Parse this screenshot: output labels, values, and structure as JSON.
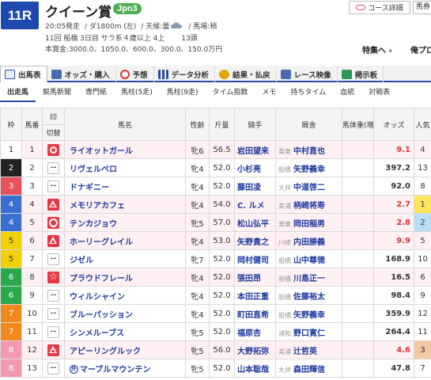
{
  "race": {
    "number": "11R",
    "name": "クイーン賞",
    "grade": "Jpn3",
    "time": "20:05発走",
    "distance": "/ ダ1800m (左)",
    "weather_label": "/ 天候:曇",
    "track": "/ 馬場:稍",
    "line2": "11回 船橋 3日目 サラ系４歳以上 4上",
    "line2_count": "13頭",
    "line3": "本賞金:3000.0、1050.0、600.0、300.0、150.0万円"
  },
  "header": {
    "course_button": "コース詳細",
    "side_button": "馬券",
    "special_link": "特集へ ›",
    "other_link": "俺プロ"
  },
  "tabs": [
    {
      "label": "出馬表",
      "icon": "document-icon"
    },
    {
      "label": "オッズ・購入",
      "icon": "odds-icon"
    },
    {
      "label": "予想",
      "icon": "target-icon"
    },
    {
      "label": "データ分析",
      "icon": "bar-chart-icon"
    },
    {
      "label": "結果・払戻",
      "icon": "coin-icon"
    },
    {
      "label": "レース映像",
      "icon": "video-icon"
    },
    {
      "label": "掲示板",
      "icon": "board-icon"
    }
  ],
  "subtabs": [
    "出走馬",
    "競馬新聞",
    "専門紙",
    "馬柱(5走)",
    "馬柱(9走)",
    "タイム指数",
    "メモ",
    "持ちタイム",
    "血統",
    "対戦表"
  ],
  "table": {
    "headers": {
      "waku": "枠",
      "umaban": "馬番",
      "mark_top": "印",
      "mark_bottom": "切替",
      "horse": "馬名",
      "sexage": "性齢",
      "kinryo": "斤量",
      "jockey": "騎手",
      "kyusha": "厩舎",
      "bw": "馬体重(増減)",
      "odds": "オッズ",
      "pop": "人気"
    },
    "rows": [
      {
        "waku": "1",
        "umaban": "1",
        "mark": "honmei",
        "name": "ライオットガール",
        "sexage": "牝6",
        "kinryo": "56.5",
        "jockey": "岩田望来",
        "area": "栗東",
        "trainer": "中村直也",
        "odds": "9.1",
        "pop": "4"
      },
      {
        "waku": "2",
        "umaban": "2",
        "mark": "none",
        "name": "リヴェルベロ",
        "sexage": "牝4",
        "kinryo": "52.0",
        "jockey": "小杉亮",
        "area": "船橋",
        "trainer": "矢野義幸",
        "odds": "397.2",
        "pop": "13"
      },
      {
        "waku": "3",
        "umaban": "3",
        "mark": "none",
        "name": "ドナギニー",
        "sexage": "牝4",
        "kinryo": "52.0",
        "jockey": "藤田凌",
        "area": "大井",
        "trainer": "中道啓二",
        "odds": "92.0",
        "pop": "8"
      },
      {
        "waku": "4",
        "umaban": "4",
        "mark": "tri",
        "name": "メモリアカフェ",
        "sexage": "牝4",
        "kinryo": "54.0",
        "jockey": "C. ルメ",
        "area": "美浦",
        "trainer": "柄崎将寿",
        "odds": "2.7",
        "pop": "1"
      },
      {
        "waku": "4",
        "umaban": "5",
        "mark": "circ",
        "name": "テンカジョウ",
        "sexage": "牝5",
        "kinryo": "57.0",
        "jockey": "松山弘平",
        "area": "栗東",
        "trainer": "岡田稲男",
        "odds": "2.8",
        "pop": "2"
      },
      {
        "waku": "5",
        "umaban": "6",
        "mark": "tri",
        "name": "ホーリーグレイル",
        "sexage": "牝4",
        "kinryo": "53.0",
        "jockey": "矢野貴之",
        "area": "川崎",
        "trainer": "内田勝義",
        "odds": "9.9",
        "pop": "5"
      },
      {
        "waku": "5",
        "umaban": "7",
        "mark": "none",
        "name": "ジゼル",
        "sexage": "牝7",
        "kinryo": "52.0",
        "jockey": "岡村健司",
        "area": "船橋",
        "trainer": "山中尊徳",
        "odds": "168.9",
        "pop": "10"
      },
      {
        "waku": "6",
        "umaban": "8",
        "mark": "star",
        "name": "プラウドフレール",
        "sexage": "牝4",
        "kinryo": "52.0",
        "jockey": "張田昂",
        "area": "船橋",
        "trainer": "川島正一",
        "odds": "16.5",
        "pop": "6"
      },
      {
        "waku": "6",
        "umaban": "9",
        "mark": "none",
        "name": "ウィルシャイン",
        "sexage": "牝4",
        "kinryo": "52.0",
        "jockey": "本田正重",
        "area": "船橋",
        "trainer": "佐藤裕太",
        "odds": "98.4",
        "pop": "9"
      },
      {
        "waku": "7",
        "umaban": "10",
        "mark": "none",
        "name": "ブルーパッション",
        "sexage": "牝4",
        "kinryo": "52.0",
        "jockey": "町田直希",
        "area": "船橋",
        "trainer": "矢野義幸",
        "odds": "359.9",
        "pop": "12"
      },
      {
        "waku": "7",
        "umaban": "11",
        "mark": "none",
        "name": "シンメルーブス",
        "sexage": "牝5",
        "kinryo": "52.0",
        "jockey": "福原杏",
        "area": "浦和",
        "trainer": "野口寛仁",
        "odds": "264.4",
        "pop": "11"
      },
      {
        "waku": "8",
        "umaban": "12",
        "mark": "tri",
        "name": "アピーリングルック",
        "sexage": "牝5",
        "kinryo": "56.0",
        "jockey": "大野拓弥",
        "area": "美浦",
        "trainer": "辻哲英",
        "odds": "4.6",
        "pop": "3"
      },
      {
        "waku": "8",
        "umaban": "13",
        "mark": "none",
        "name": "マーブルマウンテン",
        "horse_icon": "外",
        "sexage": "牝5",
        "kinryo": "52.0",
        "jockey": "山本聡哉",
        "area": "大井",
        "trainer": "森田輝信",
        "odds": "47.8",
        "pop": "7"
      }
    ]
  },
  "colors": {
    "accent": "#2a4ba3",
    "race_no_bg": "#1e4ab0",
    "grade_bg": "#4caf50",
    "odds_red": "#d33333",
    "waku": {
      "1": {
        "bg": "#ffffff",
        "fg": "#333333"
      },
      "2": {
        "bg": "#222222",
        "fg": "#ffffff"
      },
      "3": {
        "bg": "#e8505b",
        "fg": "#ffffff"
      },
      "4": {
        "bg": "#3a6fd0",
        "fg": "#ffffff"
      },
      "5": {
        "bg": "#f0d000",
        "fg": "#333333"
      },
      "6": {
        "bg": "#2aa84a",
        "fg": "#ffffff"
      },
      "7": {
        "bg": "#f08a1c",
        "fg": "#ffffff"
      },
      "8": {
        "bg": "#f49ab0",
        "fg": "#ffffff"
      }
    }
  }
}
